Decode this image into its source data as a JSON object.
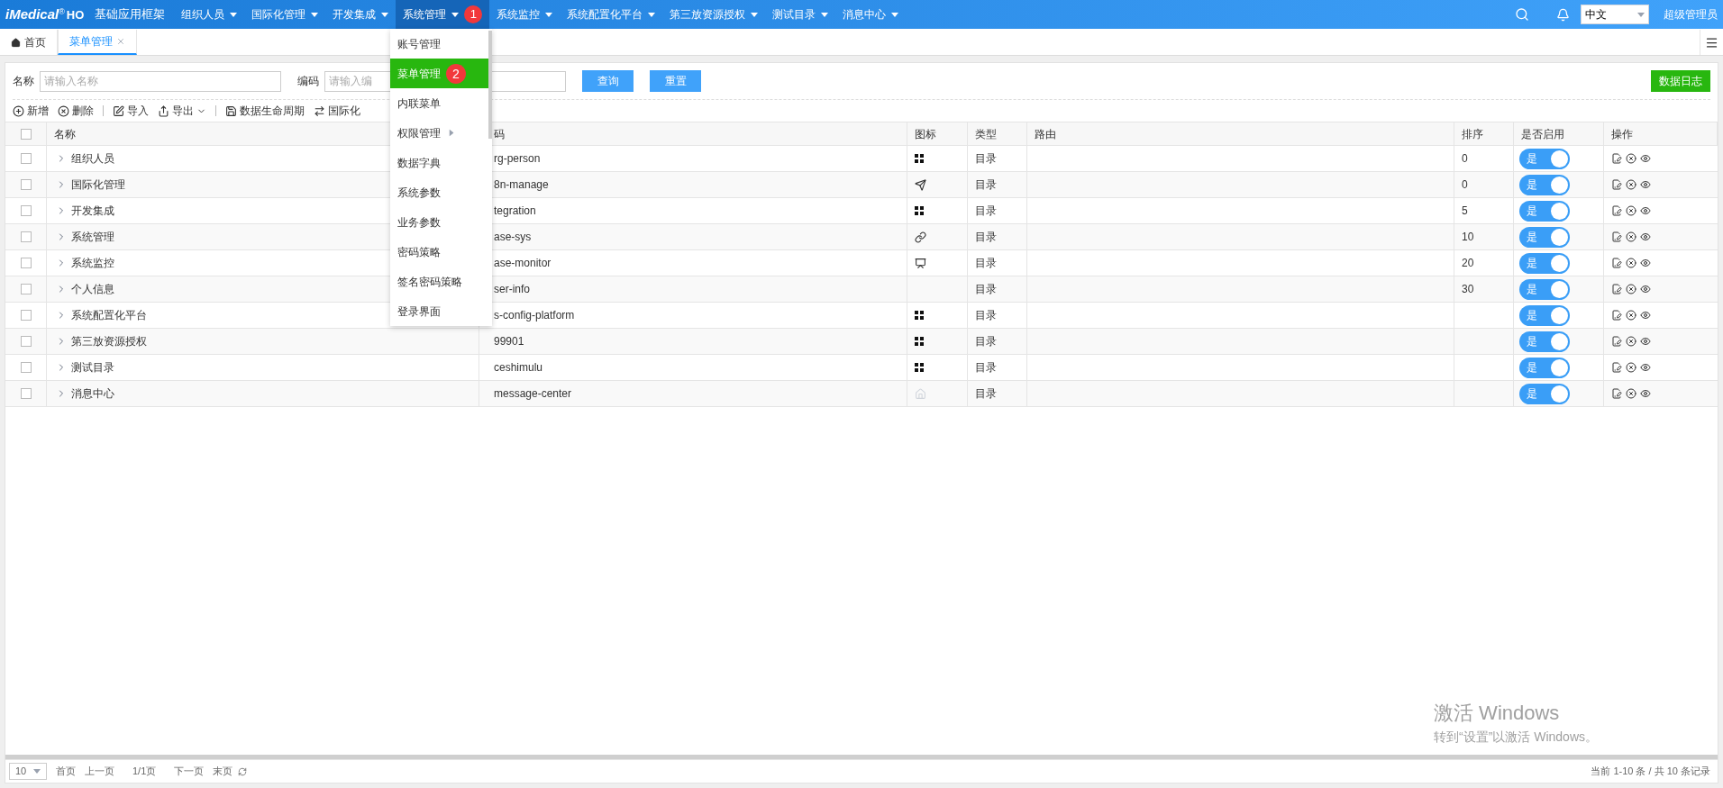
{
  "header": {
    "logo": "iMedical",
    "logo_mark": "®",
    "logo_suffix": "HO",
    "app_title": "基础应用框架",
    "nav": [
      {
        "label": "组织人员",
        "selected": false
      },
      {
        "label": "国际化管理",
        "selected": false
      },
      {
        "label": "开发集成",
        "selected": false
      },
      {
        "label": "系统管理",
        "selected": true,
        "badge": "1"
      },
      {
        "label": "系统监控",
        "selected": false
      },
      {
        "label": "系统配置化平台",
        "selected": false
      },
      {
        "label": "第三放资源授权",
        "selected": false
      },
      {
        "label": "测试目录",
        "selected": false
      },
      {
        "label": "消息中心",
        "selected": false
      }
    ],
    "language": "中文",
    "user": "超级管理员"
  },
  "tabs": [
    {
      "label": "首页",
      "selected": false,
      "closable": false
    },
    {
      "label": "菜单管理",
      "selected": true,
      "closable": true
    }
  ],
  "dropdown": [
    {
      "label": "账号管理",
      "selected": false
    },
    {
      "label": "菜单管理",
      "selected": true,
      "badge": "2"
    },
    {
      "label": "内联菜单",
      "selected": false
    },
    {
      "label": "权限管理",
      "selected": false,
      "submenu": true
    },
    {
      "label": "数据字典",
      "selected": false
    },
    {
      "label": "系统参数",
      "selected": false
    },
    {
      "label": "业务参数",
      "selected": false
    },
    {
      "label": "密码策略",
      "selected": false
    },
    {
      "label": "签名密码策略",
      "selected": false
    },
    {
      "label": "登录界面",
      "selected": false
    }
  ],
  "search": {
    "fields": [
      {
        "label": "名称",
        "placeholder": "请输入名称"
      },
      {
        "label": "编码",
        "placeholder": "请输入编"
      }
    ],
    "buttons": [
      "查询",
      "重置"
    ],
    "log_button": "数据日志"
  },
  "toolbar": [
    {
      "label": "新增",
      "has_menu": false
    },
    {
      "label": "删除",
      "has_menu": false
    },
    {
      "label": "导入",
      "has_menu": false
    },
    {
      "label": "导出",
      "has_menu": true
    },
    {
      "label": "数据生命周期",
      "has_menu": false
    },
    {
      "label": "国际化",
      "has_menu": false
    }
  ],
  "table": {
    "all_checked": false,
    "columns": [
      "名称",
      "码",
      "图标",
      "类型",
      "路由",
      "排序",
      "是否启用",
      "操作"
    ],
    "rows": [
      {
        "checked": false,
        "name": "组织人员",
        "code": "rg-person",
        "type": "目录",
        "sort": "0",
        "enabled": {
          "label": "是",
          "on": true
        }
      },
      {
        "checked": false,
        "name": "国际化管理",
        "code": "8n-manage",
        "type": "目录",
        "sort": "0",
        "enabled": {
          "label": "是",
          "on": true
        }
      },
      {
        "checked": false,
        "name": "开发集成",
        "code": "tegration",
        "type": "目录",
        "sort": "5",
        "enabled": {
          "label": "是",
          "on": true
        }
      },
      {
        "checked": false,
        "name": "系统管理",
        "code": "ase-sys",
        "type": "目录",
        "sort": "10",
        "enabled": {
          "label": "是",
          "on": true
        }
      },
      {
        "checked": false,
        "name": "系统监控",
        "code": "ase-monitor",
        "type": "目录",
        "sort": "20",
        "enabled": {
          "label": "是",
          "on": true
        }
      },
      {
        "checked": false,
        "name": "个人信息",
        "code": "ser-info",
        "type": "目录",
        "sort": "30",
        "enabled": {
          "label": "是",
          "on": true
        }
      },
      {
        "checked": false,
        "name": "系统配置化平台",
        "code": "s-config-platform",
        "type": "目录",
        "enabled": {
          "label": "是",
          "on": true
        }
      },
      {
        "checked": false,
        "name": "第三放资源授权",
        "code": "99901",
        "type": "目录",
        "enabled": {
          "label": "是",
          "on": true
        }
      },
      {
        "checked": false,
        "name": "测试目录",
        "code": "ceshimulu",
        "type": "目录",
        "enabled": {
          "label": "是",
          "on": true
        }
      },
      {
        "checked": false,
        "name": "消息中心",
        "code": "message-center",
        "type": "目录",
        "enabled": {
          "label": "是",
          "on": true
        }
      }
    ]
  },
  "pager": {
    "page_size": "10",
    "links": [
      "首页",
      "上一页",
      "1/1页",
      "下一页",
      "末页"
    ],
    "summary": "当前 1-10 条 / 共 10 条记录"
  },
  "activation_notice": {
    "title": "激活 Windows",
    "message": "转到“设置”以激活 Windows。"
  }
}
